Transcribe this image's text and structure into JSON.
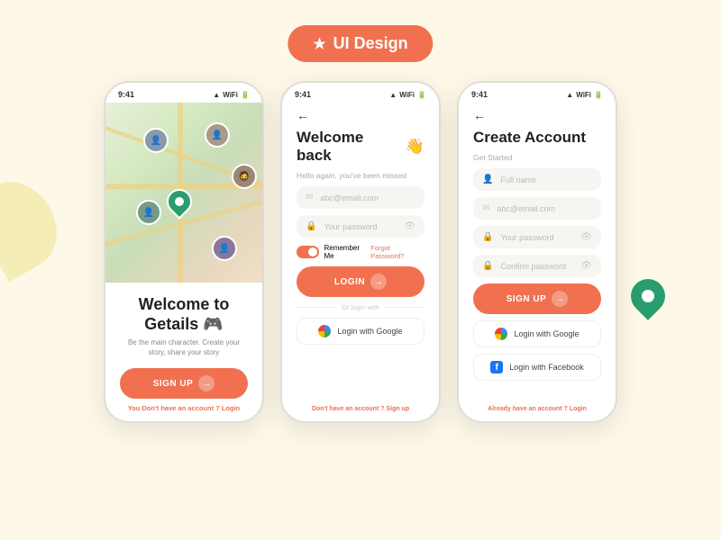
{
  "badge": {
    "star": "★",
    "label": "UI Design"
  },
  "phone1": {
    "status_time": "9:41",
    "title": "Welcome to",
    "title2": "Getails 🎮",
    "subtitle": "Be the main character.\nCreate your story, share your story",
    "signup_btn": "SIGN UP",
    "footer_text": "You Don't have an account ? ",
    "footer_link": "Login"
  },
  "phone2": {
    "status_time": "9:41",
    "back": "←",
    "title": "Welcome back",
    "emoji": "👋",
    "subtitle": "Hello again, you've been missed",
    "email_placeholder": "abc@email.com",
    "password_placeholder": "Your password",
    "remember_me": "Remember Me",
    "forgot": "Forgot Password?",
    "login_btn": "LOGIN",
    "divider_text": "Or login with",
    "google_text": "Login with Google",
    "footer_text": "Don't have an account ? ",
    "footer_link": "Sign up"
  },
  "phone3": {
    "status_time": "9:41",
    "back": "←",
    "title": "Create Account",
    "subtitle": "Get Started",
    "fullname_placeholder": "Full name",
    "email_placeholder": "abc@email.com",
    "password_placeholder": "Your password",
    "confirm_placeholder": "Confirm password",
    "signup_btn": "SIGN UP",
    "google_text": "Login with Google",
    "facebook_text": "Login with Facebook",
    "footer_text": "Already have an account ? ",
    "footer_link": "Login"
  }
}
